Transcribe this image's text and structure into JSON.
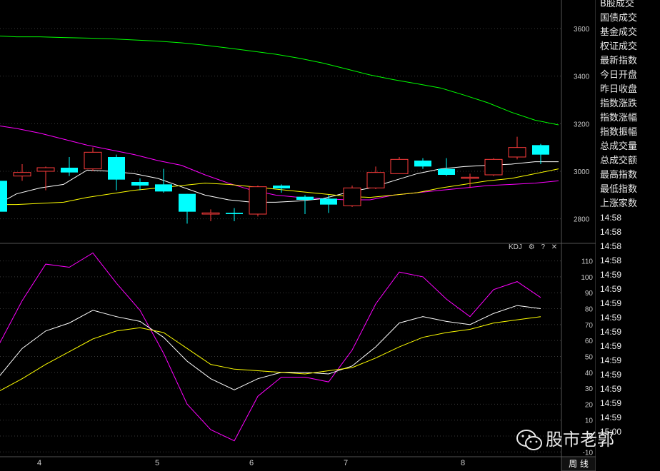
{
  "chart_data": [
    {
      "type": "candlestick",
      "title": "",
      "x_labels": [
        "4",
        "5",
        "6",
        "7",
        "8"
      ],
      "yticks": [
        2800,
        3000,
        3200,
        3400,
        3600
      ],
      "ylim": [
        2700,
        3720
      ],
      "grid": true,
      "candles": [
        {
          "o": 2960,
          "c": 2830,
          "h": 2980,
          "l": 2810,
          "color": "cyan"
        },
        {
          "o": 2980,
          "c": 2995,
          "h": 3030,
          "l": 2960,
          "color": "red"
        },
        {
          "o": 3000,
          "c": 3015,
          "h": 3020,
          "l": 2920,
          "color": "red"
        },
        {
          "o": 3015,
          "c": 2995,
          "h": 3060,
          "l": 2980,
          "color": "cyan"
        },
        {
          "o": 3010,
          "c": 3080,
          "h": 3100,
          "l": 3000,
          "color": "red"
        },
        {
          "o": 3060,
          "c": 2965,
          "h": 3070,
          "l": 2920,
          "color": "cyan"
        },
        {
          "o": 2955,
          "c": 2940,
          "h": 2970,
          "l": 2920,
          "color": "cyan"
        },
        {
          "o": 2945,
          "c": 2915,
          "h": 3010,
          "l": 2910,
          "color": "cyan"
        },
        {
          "o": 2905,
          "c": 2830,
          "h": 2905,
          "l": 2780,
          "color": "cyan"
        },
        {
          "o": 2820,
          "c": 2825,
          "h": 2840,
          "l": 2790,
          "color": "red"
        },
        {
          "o": 2825,
          "c": 2820,
          "h": 2845,
          "l": 2790,
          "color": "cyan"
        },
        {
          "o": 2820,
          "c": 2935,
          "h": 2940,
          "l": 2810,
          "color": "red"
        },
        {
          "o": 2940,
          "c": 2928,
          "h": 2945,
          "l": 2910,
          "color": "cyan"
        },
        {
          "o": 2893,
          "c": 2880,
          "h": 2900,
          "l": 2820,
          "color": "cyan"
        },
        {
          "o": 2885,
          "c": 2860,
          "h": 2900,
          "l": 2825,
          "color": "cyan"
        },
        {
          "o": 2855,
          "c": 2930,
          "h": 2940,
          "l": 2850,
          "color": "red"
        },
        {
          "o": 2930,
          "c": 2995,
          "h": 3020,
          "l": 2925,
          "color": "red"
        },
        {
          "o": 2990,
          "c": 3050,
          "h": 3060,
          "l": 2990,
          "color": "red"
        },
        {
          "o": 3045,
          "c": 3020,
          "h": 3055,
          "l": 3010,
          "color": "cyan"
        },
        {
          "o": 3010,
          "c": 2985,
          "h": 3055,
          "l": 2980,
          "color": "cyan"
        },
        {
          "o": 2970,
          "c": 2975,
          "h": 2990,
          "l": 2930,
          "color": "red"
        },
        {
          "o": 2985,
          "c": 3050,
          "h": 3055,
          "l": 2980,
          "color": "red"
        },
        {
          "o": 3060,
          "c": 3100,
          "h": 3145,
          "l": 3050,
          "color": "red"
        },
        {
          "o": 3070,
          "c": 3110,
          "h": 3115,
          "l": 3030,
          "color": "cyan"
        }
      ],
      "series": [
        {
          "name": "",
          "color": "#00ff00",
          "values": [
            3570,
            3565,
            3565,
            3562,
            3560,
            3557,
            3552,
            3547,
            3540,
            3530,
            3518,
            3505,
            3492,
            3475,
            3455,
            3430,
            3405,
            3385,
            3368,
            3350,
            3320,
            3288,
            3248,
            3215,
            3195
          ]
        },
        {
          "name": "",
          "color": "#ff00ff",
          "values": [
            3195,
            3180,
            3160,
            3135,
            3110,
            3090,
            3070,
            3045,
            3025,
            2985,
            2950,
            2920,
            2900,
            2890,
            2885,
            2880,
            2880,
            2900,
            2910,
            2920,
            2930,
            2940,
            2945,
            2950,
            2960
          ]
        },
        {
          "name": "",
          "color": "#ffffff",
          "values": [
            2850,
            2905,
            2930,
            2945,
            3005,
            3000,
            2990,
            2970,
            2935,
            2900,
            2880,
            2870,
            2870,
            2875,
            2885,
            2910,
            2930,
            2960,
            2990,
            3010,
            3020,
            3025,
            3030,
            3040,
            3040
          ]
        },
        {
          "name": "",
          "color": "#ffff00",
          "values": [
            2860,
            2860,
            2865,
            2870,
            2890,
            2905,
            2920,
            2930,
            2940,
            2950,
            2945,
            2935,
            2925,
            2915,
            2905,
            2895,
            2890,
            2900,
            2910,
            2930,
            2945,
            2960,
            2970,
            2990,
            3010
          ]
        }
      ]
    },
    {
      "type": "line",
      "title": "KDJ",
      "yticks": [
        -10,
        0,
        10,
        20,
        30,
        40,
        50,
        60,
        70,
        80,
        90,
        100,
        110
      ],
      "ylim": [
        -13,
        117
      ],
      "grid": true,
      "series": [
        {
          "name": "",
          "color": "#ff00ff",
          "values": [
            57,
            85,
            108,
            106,
            115,
            96,
            79,
            52,
            20,
            4,
            -3,
            25,
            37,
            37,
            34,
            54,
            83,
            103,
            100,
            86,
            75,
            92,
            97,
            87
          ]
        },
        {
          "name": "",
          "color": "#ffffff",
          "values": [
            37,
            55,
            66,
            71,
            79,
            75,
            72,
            62,
            47,
            36,
            29,
            36,
            40,
            40,
            39,
            44,
            56,
            71,
            75,
            72,
            70,
            77,
            82,
            80
          ]
        },
        {
          "name": "",
          "color": "#ffff00",
          "values": [
            28,
            36,
            45,
            53,
            61,
            66,
            68,
            65,
            55,
            45,
            42,
            41,
            40,
            39,
            41,
            43,
            49,
            56,
            62,
            65,
            67,
            71,
            73,
            75
          ]
        }
      ]
    }
  ],
  "kdj_toolbar": {
    "label": "KDJ",
    "settings": "⚙",
    "help": "?",
    "close": "✕"
  },
  "right_list": [
    "B股成交",
    "国债成交",
    "基金成交",
    "权证成交",
    "最新指数",
    "今日开盘",
    "昨日收盘",
    "指数涨跌",
    "指数涨幅",
    "指数振幅",
    "总成交量",
    "总成交额",
    "最高指数",
    "最低指数",
    "上涨家数"
  ],
  "time_list": [
    "14:58",
    "14:58",
    "14:58",
    "14:58",
    "14:59",
    "14:59",
    "14:59",
    "14:59",
    "14:59",
    "14:59",
    "14:59",
    "14:59",
    "14:59",
    "14:59",
    "14:59",
    "15:00"
  ],
  "period_button": "周 线",
  "watermark": "股市老郭"
}
